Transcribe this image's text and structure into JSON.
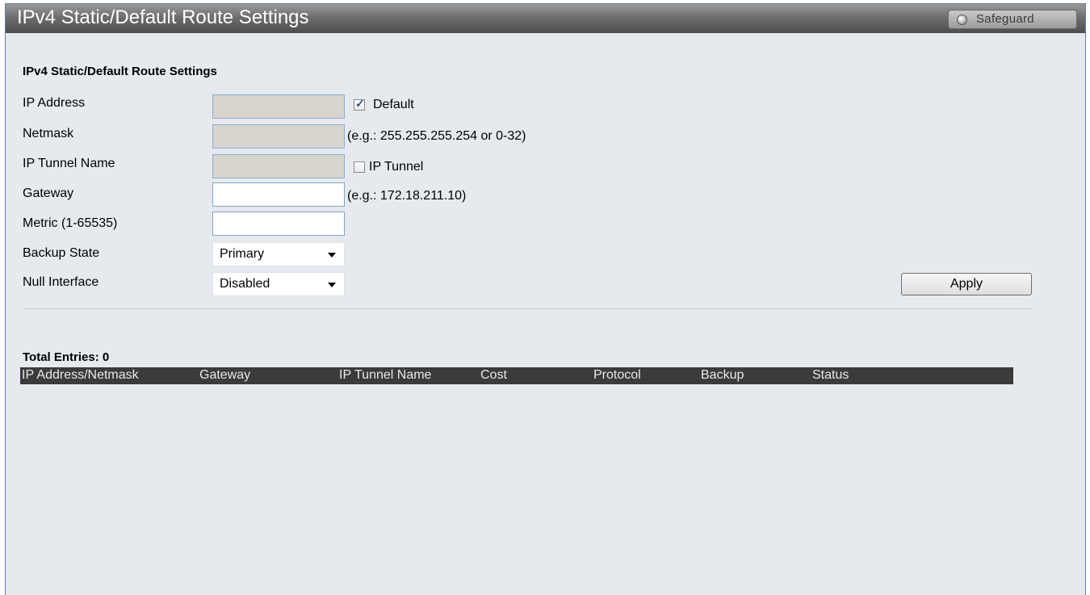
{
  "header": {
    "title": "IPv4 Static/Default Route Settings",
    "safeguard_label": "Safeguard"
  },
  "form": {
    "section_title": "IPv4 Static/Default Route Settings",
    "ip_address": {
      "label": "IP Address",
      "value": "",
      "default_checked": true,
      "default_label": "Default"
    },
    "netmask": {
      "label": "Netmask",
      "value": "",
      "hint": "(e.g.: 255.255.255.254 or 0-32)"
    },
    "ip_tunnel_name": {
      "label": "IP Tunnel Name",
      "value": "",
      "tunnel_checked": false,
      "tunnel_label": "IP Tunnel"
    },
    "gateway": {
      "label": "Gateway",
      "value": "",
      "hint": "(e.g.: 172.18.211.10)"
    },
    "metric": {
      "label": "Metric (1-65535)",
      "value": ""
    },
    "backup_state": {
      "label": "Backup State",
      "selected": "Primary"
    },
    "null_interface": {
      "label": "Null Interface",
      "selected": "Disabled"
    },
    "apply_label": "Apply"
  },
  "table": {
    "total_entries": "Total Entries: 0",
    "columns": [
      "IP Address/Netmask",
      "Gateway",
      "IP Tunnel Name",
      "Cost",
      "Protocol",
      "Backup",
      "Status"
    ],
    "rows": []
  },
  "colors": {
    "panel_bg": "#e6eaee",
    "header_dark": "#3b3b3b",
    "input_border": "#7fa3c7",
    "disabled_input": "#d8d4ce"
  }
}
